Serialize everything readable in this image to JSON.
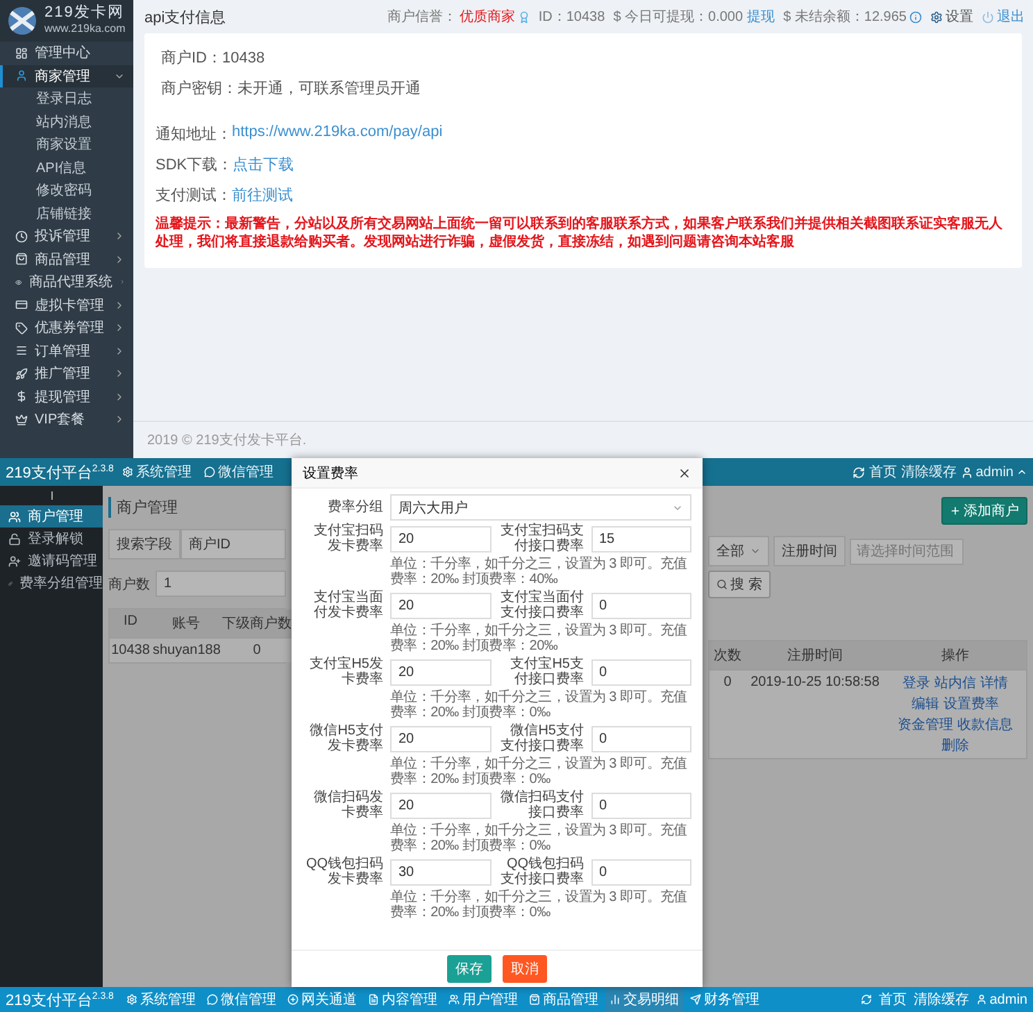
{
  "top": {
    "logo": {
      "title": "219发卡网",
      "subtitle": "www.219ka.com"
    },
    "sidebar": [
      {
        "label": "管理中心",
        "selected": false
      },
      {
        "label": "商家管理",
        "selected": true,
        "expanded": true,
        "children": [
          {
            "label": "登录日志"
          },
          {
            "label": "站内消息"
          },
          {
            "label": "商家设置"
          },
          {
            "label": "API信息"
          },
          {
            "label": "修改密码"
          },
          {
            "label": "店铺链接"
          }
        ]
      },
      {
        "label": "投诉管理",
        "selected": false,
        "expanded": false
      },
      {
        "label": "商品管理",
        "selected": false,
        "expanded": false
      },
      {
        "label": "商品代理系统",
        "selected": false,
        "expanded": false
      },
      {
        "label": "虚拟卡管理",
        "selected": false,
        "expanded": false
      },
      {
        "label": "优惠券管理",
        "selected": false,
        "expanded": false
      },
      {
        "label": "订单管理",
        "selected": false,
        "expanded": false
      },
      {
        "label": "推广管理",
        "selected": false,
        "expanded": false
      },
      {
        "label": "提现管理",
        "selected": false,
        "expanded": false
      },
      {
        "label": "VIP套餐",
        "selected": false,
        "expanded": false
      }
    ],
    "header": {
      "title": "api支付信息",
      "reputation_label": "商户信誉：",
      "reputation": "优质商家",
      "id": "ID：10438",
      "withdrawable": "$ 今日可提现：0.000",
      "withdraw_link": "提现",
      "balance": "$ 未结余额：12.965",
      "settings": "设置",
      "logout": "退出"
    },
    "card": {
      "lines": [
        "商户ID：10438",
        "商户密钥：未开通，可联系管理员开通"
      ],
      "links": [
        {
          "label": "通知地址：",
          "value": "https://www.219ka.com/pay/api"
        },
        {
          "label": "SDK下载：",
          "value": "点击下载"
        },
        {
          "label": "支付测试：",
          "value": "前往测试"
        }
      ],
      "notice": "温馨提示：最新警告，分站以及所有交易网站上面统一留可以联系到的客服联系方式，如果客户联系我们并提供相关截图联系证实客服无人处理，我们将直接退款给购买者。发现网站进行诈骗，虚假发货，直接冻结，如遇到问题请咨询本站客服"
    },
    "footer": "2019 © 219支付发卡平台."
  },
  "bottom": {
    "topbar": {
      "brand": "219支付平台",
      "version": "2.3.8",
      "nav": [
        "系统管理",
        "微信管理"
      ],
      "right": [
        "首页",
        "清除缓存",
        "admin"
      ]
    },
    "sidebar": [
      {
        "label": "商户管理",
        "selected": true
      },
      {
        "label": "登录解锁",
        "selected": false
      },
      {
        "label": "邀请码管理",
        "selected": false
      },
      {
        "label": "费率分组管理",
        "selected": false
      }
    ],
    "page_title": "商户管理",
    "search": {
      "field_label": "搜索字段",
      "field_value": "商户ID",
      "status_value": "全部",
      "date_label": "注册时间",
      "date_placeholder": "请选择时间范围",
      "search_button": "搜 索",
      "add_button": "添加商户"
    },
    "count": {
      "label": "商户数",
      "value": "1"
    },
    "table_left": {
      "columns": [
        "ID",
        "账号",
        "下级商户数"
      ],
      "rows": [
        [
          "10438",
          "shuyan188",
          "0"
        ]
      ]
    },
    "table_right": {
      "columns": [
        "次数",
        "注册时间",
        "操作"
      ],
      "rows": [
        {
          "cells": [
            "0",
            "2019-10-25 10:58:58"
          ],
          "actions": [
            "登录",
            "站内信",
            "详情",
            "编辑",
            "设置费率",
            "资金管理",
            "收款信息",
            "删除"
          ]
        }
      ]
    },
    "modal": {
      "title": "设置费率",
      "group_label": "费率分组",
      "group_value": "周六大用户",
      "rows": [
        {
          "left_label": "支付宝扫码发卡费率",
          "left_value": "20",
          "right_label": "支付宝扫码支付接口费率",
          "right_value": "15",
          "note": "单位：千分率，如千分之三，设置为 3 即可。充值费率：20‰ 封顶费率：40‰"
        },
        {
          "left_label": "支付宝当面付发卡费率",
          "left_value": "20",
          "right_label": "支付宝当面付支付接口费率",
          "right_value": "0",
          "note": "单位：千分率，如千分之三，设置为 3 即可。充值费率：20‰ 封顶费率：20‰"
        },
        {
          "left_label": "支付宝H5发卡费率",
          "left_value": "20",
          "right_label": "支付宝H5支付接口费率",
          "right_value": "0",
          "note": "单位：千分率，如千分之三，设置为 3 即可。充值费率：20‰ 封顶费率：0‰"
        },
        {
          "left_label": "微信H5支付发卡费率",
          "left_value": "20",
          "right_label": "微信H5支付支付接口费率",
          "right_value": "0",
          "note": "单位：千分率，如千分之三，设置为 3 即可。充值费率：20‰ 封顶费率：0‰"
        },
        {
          "left_label": "微信扫码发卡费率",
          "left_value": "20",
          "right_label": "微信扫码支付接口费率",
          "right_value": "0",
          "note": "单位：千分率，如千分之三，设置为 3 即可。充值费率：20‰ 封顶费率：0‰"
        },
        {
          "left_label": "QQ钱包扫码发卡费率",
          "left_value": "30",
          "right_label": "QQ钱包扫码支付接口费率",
          "right_value": "0",
          "note": "单位：千分率，如千分之三，设置为 3 即可。充值费率：20‰ 封顶费率：0‰"
        }
      ],
      "buttons": [
        {
          "label": "保存",
          "kind": "primary"
        },
        {
          "label": "取消",
          "kind": "danger"
        }
      ]
    }
  },
  "taskbar": {
    "brand": "219支付平台",
    "version": "2.3.8",
    "nav": [
      {
        "label": "系统管理",
        "selected": false
      },
      {
        "label": "微信管理",
        "selected": false
      },
      {
        "label": "网关通道",
        "selected": false
      },
      {
        "label": "内容管理",
        "selected": false
      },
      {
        "label": "用户管理",
        "selected": false
      },
      {
        "label": "商品管理",
        "selected": false
      },
      {
        "label": "交易明细",
        "selected": true
      },
      {
        "label": "财务管理",
        "selected": false
      }
    ],
    "right": [
      "首页",
      "清除缓存",
      "admin"
    ]
  }
}
